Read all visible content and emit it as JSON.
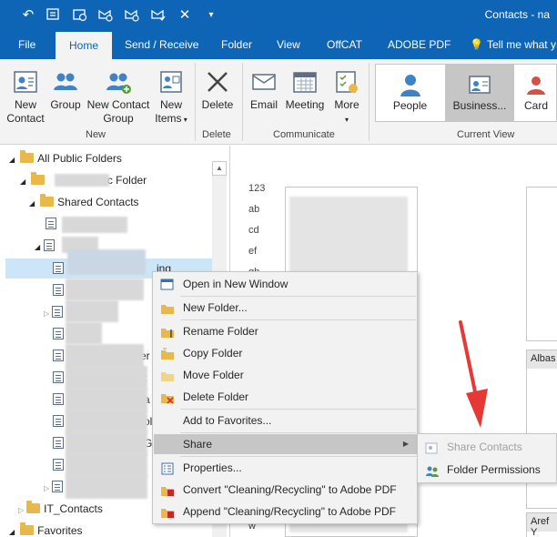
{
  "window": {
    "title": "Contacts - na"
  },
  "qat": {
    "icons": [
      "undo-icon",
      "send-receive-all-icon",
      "update-folder-icon",
      "send-receive-icon",
      "send-receive-group-icon",
      "send-icon",
      "delete-all-icon",
      "customize-qat-icon"
    ]
  },
  "tabs": [
    {
      "label": "File"
    },
    {
      "label": "Home"
    },
    {
      "label": "Send / Receive"
    },
    {
      "label": "Folder"
    },
    {
      "label": "View"
    },
    {
      "label": "OffCAT"
    },
    {
      "label": "ADOBE PDF"
    },
    {
      "label": "Tell me what y"
    }
  ],
  "ribbon": {
    "new_contact": "New Contact",
    "new_contact_l1": "New",
    "new_contact_l2": "Contact",
    "group": "Group",
    "new_contact_group_l1": "New Contact",
    "new_contact_group_l2": "Group",
    "new_items_l1": "New",
    "new_items_l2": "Items",
    "new_label": "New",
    "delete": "Delete",
    "delete_label": "Delete",
    "email": "Email",
    "meeting": "Meeting",
    "more": "More",
    "communicate_label": "Communicate",
    "view_people": "People",
    "view_business": "Business...",
    "view_card": "Card",
    "current_view_label": "Current View"
  },
  "folders": {
    "all_public": "All Public Folders",
    "public_folder_suffix": "ic Folder",
    "shared_contacts": "Shared Contacts",
    "selected_suffix": "ing",
    "suffix_er": "er",
    "suffix_t": "t",
    "suffix_a": "a",
    "suffix_ol": "ol",
    "suffix_g": "G",
    "it_contacts": "IT_Contacts",
    "favorites": "Favorites"
  },
  "content": {
    "alpha_index": [
      "123",
      "ab",
      "cd",
      "ef",
      "gh"
    ],
    "card_albas": "Albas",
    "card_aref": "Aref Y",
    "letter_w": "w"
  },
  "context_menu": {
    "items": [
      {
        "label": "Open in New Window"
      },
      {
        "label": "New Folder..."
      },
      {
        "label": "Rename Folder"
      },
      {
        "label": "Copy Folder"
      },
      {
        "label": "Move Folder"
      },
      {
        "label": "Delete Folder"
      },
      {
        "label": "Add to Favorites..."
      },
      {
        "label": "Share"
      },
      {
        "label": "Properties..."
      },
      {
        "label": "Convert \"Cleaning/Recycling\" to Adobe PDF"
      },
      {
        "label": "Append \"Cleaning/Recycling\" to Adobe PDF"
      }
    ]
  },
  "submenu": {
    "items": [
      {
        "label": "Share Contacts",
        "disabled": true
      },
      {
        "label": "Folder Permissions",
        "disabled": false
      }
    ]
  },
  "colors": {
    "brand_blue": "#0e64b5",
    "ribbon_bg": "#f3f3f3",
    "highlight": "#c6c6c6",
    "annotation_red": "#e53935",
    "folder_yellow": "#e8b84a"
  }
}
